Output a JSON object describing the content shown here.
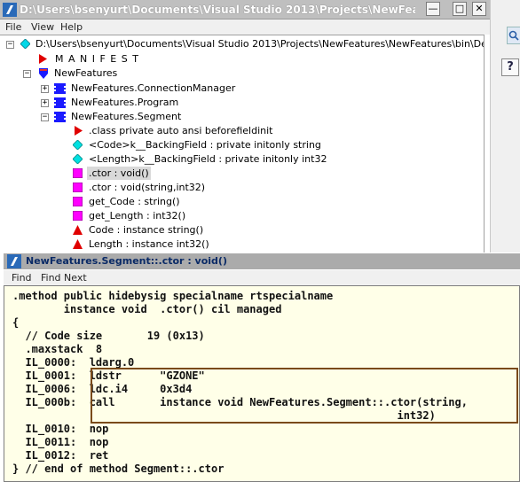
{
  "main_window": {
    "title": "D:\\Users\\bsenyurt\\Documents\\Visual Studio 2013\\Projects\\NewFeatures\\NewFe...",
    "minimize_glyph": "—",
    "maximize_glyph": "□",
    "close_glyph": "✕"
  },
  "menu": {
    "file": "File",
    "view": "View",
    "help": "Help"
  },
  "tree": {
    "root": "D:\\Users\\bsenyurt\\Documents\\Visual Studio 2013\\Projects\\NewFeatures\\NewFeatures\\bin\\Debug\\NewFe",
    "manifest": "M A N I F E S T",
    "namespace": "NewFeatures",
    "class_connection_manager": "NewFeatures.ConnectionManager",
    "class_program": "NewFeatures.Program",
    "class_segment": "NewFeatures.Segment",
    "class_directive": ".class private auto ansi beforefieldinit",
    "field_code": "<Code>k__BackingField : private initonly string",
    "field_length": "<Length>k__BackingField : private initonly int32",
    "ctor_default": ".ctor : void()",
    "ctor_params": ".ctor : void(string,int32)",
    "method_get_code": "get_Code : string()",
    "method_get_length": "get_Length : int32()",
    "prop_code": "Code : instance string()",
    "prop_length": "Length : instance int32()"
  },
  "code_window": {
    "title": "NewFeatures.Segment::.ctor : void()",
    "menu_find": "Find",
    "menu_find_next": "Find Next",
    "lines": [
      ".method public hidebysig specialname rtspecialname",
      "        instance void  .ctor() cil managed",
      "{",
      "  // Code size       19 (0x13)",
      "  .maxstack  8",
      "  IL_0000:  ldarg.0",
      "  IL_0001:  ldstr      \"GZONE\"",
      "  IL_0006:  ldc.i4     0x3d4",
      "  IL_000b:  call       instance void NewFeatures.Segment::.ctor(string,",
      "                                                            int32)",
      "  IL_0010:  nop",
      "  IL_0011:  nop",
      "  IL_0012:  ret",
      "} // end of method Segment::.ctor"
    ]
  },
  "icons": {
    "app": "ildasm-icon",
    "manifest": "manifest-triangle-icon",
    "namespace": "namespace-shield-icon",
    "class": "class-icon",
    "field": "field-diamond-icon",
    "method": "method-square-icon",
    "property": "property-triangle-icon"
  },
  "colors": {
    "class_blue": "#1a1aff",
    "method_magenta": "#ff00ff",
    "field_cyan": "#00e0e0",
    "manifest_red": "#e00000",
    "highlight_border": "#7a4a1a",
    "code_bg": "#ffffe8"
  }
}
